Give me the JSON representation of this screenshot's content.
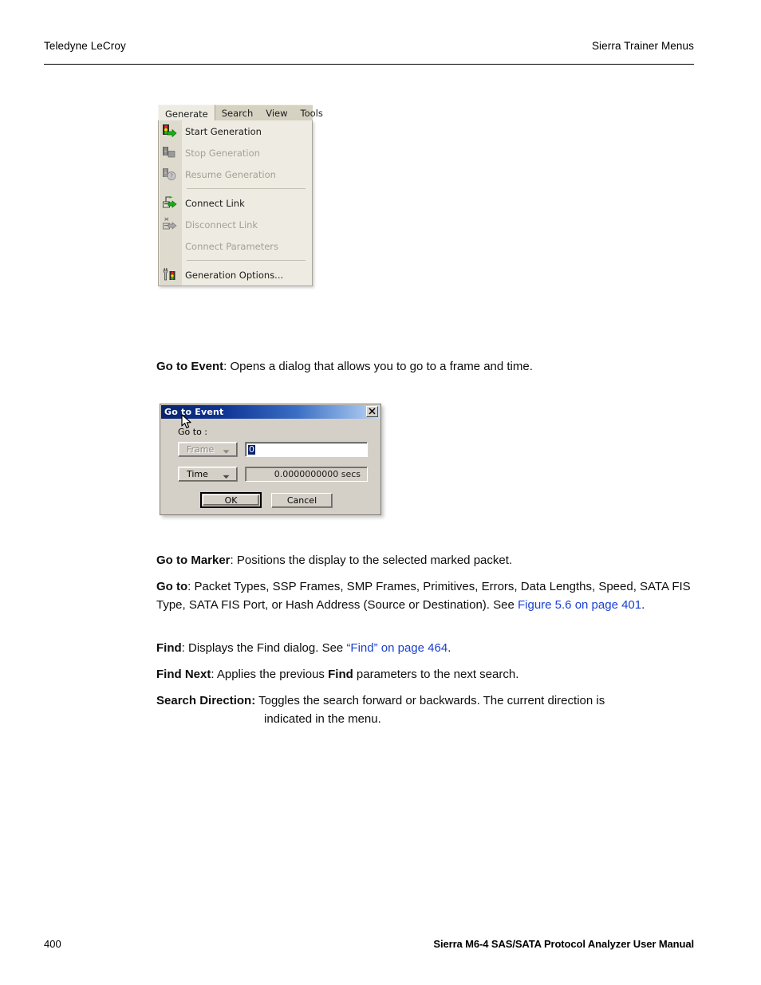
{
  "header": {
    "left": "Teledyne LeCroy",
    "right": "Sierra Trainer Menus"
  },
  "footer": {
    "page_number": "400",
    "manual_title": "Sierra M6-4 SAS/SATA Protocol Analyzer User Manual"
  },
  "menu_figure": {
    "menubar": [
      {
        "label": "Generate",
        "active": true
      },
      {
        "label": "Search",
        "active": false
      },
      {
        "label": "View",
        "active": false
      },
      {
        "label": "Tools",
        "active": false
      }
    ],
    "items": [
      {
        "label": "Start Generation",
        "icon": "start-generation-icon",
        "disabled": false
      },
      {
        "label": "Stop Generation",
        "icon": "stop-generation-icon",
        "disabled": true
      },
      {
        "label": "Resume Generation",
        "icon": "resume-generation-icon",
        "disabled": true
      },
      {
        "label": "Connect Link",
        "icon": "connect-link-icon",
        "disabled": false
      },
      {
        "label": "Disconnect Link",
        "icon": "disconnect-link-icon",
        "disabled": true
      },
      {
        "label": "Connect Parameters",
        "icon": "connect-parameters-icon",
        "disabled": true
      },
      {
        "label": "Generation Options...",
        "icon": "generation-options-icon",
        "disabled": false
      }
    ]
  },
  "dialog": {
    "title": "Go to Event",
    "close_label": "✕",
    "goto_label": "Go to :",
    "frame_combo": {
      "value": "Frame",
      "disabled": true
    },
    "frame_input": {
      "value": "0"
    },
    "time_combo": {
      "value": "Time",
      "disabled": false
    },
    "time_value": "0.0000000000 secs",
    "ok_label": "OK",
    "cancel_label": "Cancel"
  },
  "content": {
    "go_to_event": {
      "term": "Go to Event",
      "rest": ": Opens a dialog that allows you to go to a frame and time."
    },
    "go_to_marker": {
      "term": "Go to Marker",
      "rest": ": Positions the display to the selected marked packet."
    },
    "go_to": {
      "term": "Go to",
      "rest_a": ": Packet Types, SSP Frames, SMP Frames, Primitives, Errors, Data Lengths, Speed, SATA FIS Type, SATA FIS Port, or Hash Address (Source or Destination). See ",
      "link": "Figure 5.6 on page 401",
      "rest_b": "."
    },
    "find": {
      "term": "Find",
      "rest_a": ": Displays the Find dialog. See ",
      "link": "“Find” on page 464",
      "rest_b": "."
    },
    "find_next": {
      "term": "Find Next",
      "rest_a": ": Applies the previous ",
      "term_inline": "Find",
      "rest_b": " parameters to the next search."
    },
    "search_direction": {
      "term": "Search Direction:",
      "rest_a": " Toggles the search forward or backwards. The current direction is",
      "rest_b": "indicated in the menu."
    }
  },
  "colors": {
    "link": "#1a3fd0",
    "menu_face": "#eeece2",
    "menu_gutter": "#dedbce",
    "dialog_face": "#d4d0c8",
    "titlebar_dark": "#0a246a",
    "titlebar_light": "#c6dcf6",
    "selection": "#0a246a"
  }
}
